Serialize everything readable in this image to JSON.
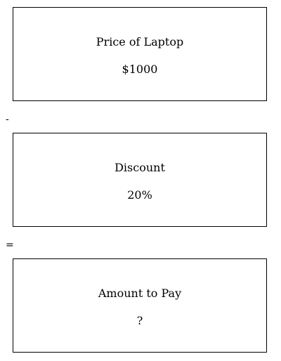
{
  "boxes": [
    {
      "title": "Price of Laptop",
      "value": "$1000"
    },
    {
      "title": "Discount",
      "value": "20%"
    },
    {
      "title": "Amount to Pay",
      "value": "?"
    }
  ],
  "operators": {
    "minus": "-",
    "equals": "="
  }
}
